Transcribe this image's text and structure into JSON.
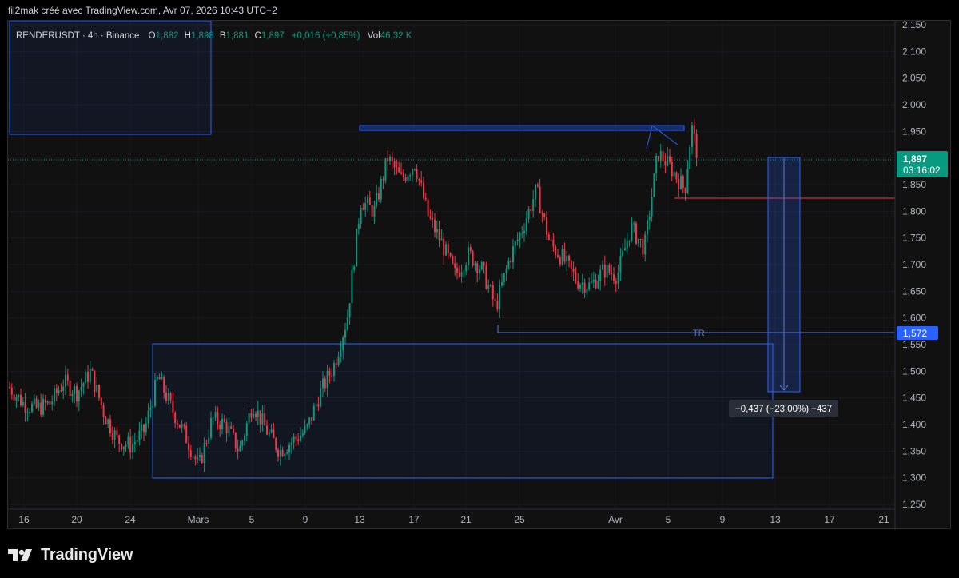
{
  "header": {
    "attribution": "fil2mak créé avec TradingView.com, Avr 07, 2026 10:43 UTC+2"
  },
  "legend": {
    "symbol": "RENDERUSDT · 4h · Binance",
    "o_label": "O",
    "o_value": "1,882",
    "h_label": "H",
    "h_value": "1,898",
    "b_label": "B",
    "b_value": "1,881",
    "c_label": "C",
    "c_value": "1,897",
    "change": "+0,016 (+0,85%)",
    "vol_label": "Vol",
    "vol_value": "46,32 K"
  },
  "price_axis": {
    "labels": [
      "2,150",
      "2,100",
      "2,050",
      "2,000",
      "1,950",
      "1,900",
      "1,850",
      "1,800",
      "1,750",
      "1,700",
      "1,650",
      "1,600",
      "1,550",
      "1,500",
      "1,450",
      "1,400",
      "1,350",
      "1,300",
      "1,250"
    ]
  },
  "time_axis": {
    "labels": [
      "16",
      "20",
      "24",
      "Mars",
      "5",
      "9",
      "13",
      "17",
      "21",
      "25",
      "Avr",
      "5",
      "9",
      "13",
      "17",
      "21"
    ]
  },
  "current_price": {
    "price": "1,897",
    "countdown": "03:16:02"
  },
  "level_label": {
    "price": "1,572"
  },
  "tr_label": "TR",
  "measure_label": "−0,437 (−23,00%) −437",
  "footer": {
    "brand": "TradingView"
  },
  "colors": {
    "up": "#089981",
    "down": "#f23645",
    "blue": "#2962ff",
    "background": "#111111",
    "text": "#d1d4dc"
  },
  "chart_data": {
    "type": "candlestick",
    "symbol": "RENDERUSDT",
    "timeframe": "4h",
    "exchange": "Binance",
    "ylim": [
      1.22,
      2.17
    ],
    "current_close": 1.897,
    "legend_ohlc": {
      "open": 1.882,
      "high": 1.898,
      "low": 1.881,
      "close": 1.897
    },
    "price_path": [
      [
        "Feb 15",
        1.47
      ],
      [
        "Feb 16",
        1.44
      ],
      [
        "Feb 17",
        1.43
      ],
      [
        "Feb 18",
        1.44
      ],
      [
        "Feb 19",
        1.48
      ],
      [
        "Feb 20",
        1.46
      ],
      [
        "Feb 21",
        1.5
      ],
      [
        "Feb 22",
        1.42
      ],
      [
        "Feb 23",
        1.37
      ],
      [
        "Feb 24",
        1.36
      ],
      [
        "Feb 25",
        1.39
      ],
      [
        "Feb 26",
        1.49
      ],
      [
        "Feb 27",
        1.43
      ],
      [
        "Feb 28",
        1.38
      ],
      [
        "Mar 1",
        1.32
      ],
      [
        "Mar 2",
        1.41
      ],
      [
        "Mar 3",
        1.4
      ],
      [
        "Mar 4",
        1.35
      ],
      [
        "Mar 5",
        1.44
      ],
      [
        "Mar 6",
        1.39
      ],
      [
        "Mar 7",
        1.35
      ],
      [
        "Mar 8",
        1.37
      ],
      [
        "Mar 9",
        1.39
      ],
      [
        "Mar 10",
        1.46
      ],
      [
        "Mar 11",
        1.51
      ],
      [
        "Mar 12",
        1.6
      ],
      [
        "Mar 13",
        1.82
      ],
      [
        "Mar 14",
        1.8
      ],
      [
        "Mar 15",
        1.9
      ],
      [
        "Mar 16",
        1.86
      ],
      [
        "Mar 17",
        1.89
      ],
      [
        "Mar 18",
        1.79
      ],
      [
        "Mar 19",
        1.74
      ],
      [
        "Mar 20",
        1.68
      ],
      [
        "Mar 21",
        1.72
      ],
      [
        "Mar 22",
        1.69
      ],
      [
        "Mar 23",
        1.62
      ],
      [
        "Mar 24",
        1.71
      ],
      [
        "Mar 25",
        1.77
      ],
      [
        "Mar 26",
        1.84
      ],
      [
        "Mar 27",
        1.74
      ],
      [
        "Mar 28",
        1.71
      ],
      [
        "Mar 29",
        1.67
      ],
      [
        "Mar 30",
        1.66
      ],
      [
        "Mar 31",
        1.69
      ],
      [
        "Apr 1",
        1.68
      ],
      [
        "Apr 2",
        1.77
      ],
      [
        "Apr 3",
        1.73
      ],
      [
        "Apr 4",
        1.91
      ],
      [
        "Apr 5",
        1.88
      ],
      [
        "Apr 6",
        1.84
      ],
      [
        "Apr 6 12h",
        1.96
      ],
      [
        "Apr 7",
        1.897
      ]
    ],
    "range_box": {
      "top": 1.953,
      "from": "Mar 13",
      "to": "Apr 6"
    },
    "demand_zone": {
      "top": 1.55,
      "bottom": 1.3,
      "from": "Feb 26",
      "to": "Apr 13"
    },
    "supply_zone_top_left": {
      "top": 2.15,
      "bottom": 1.945,
      "from": "Feb 15",
      "to": "Feb 22"
    },
    "tr_level": 1.572,
    "red_level": 1.821,
    "measure": {
      "from": 1.897,
      "to": 1.46,
      "change": -0.437,
      "percent": -23.0,
      "ticks": -437
    }
  }
}
